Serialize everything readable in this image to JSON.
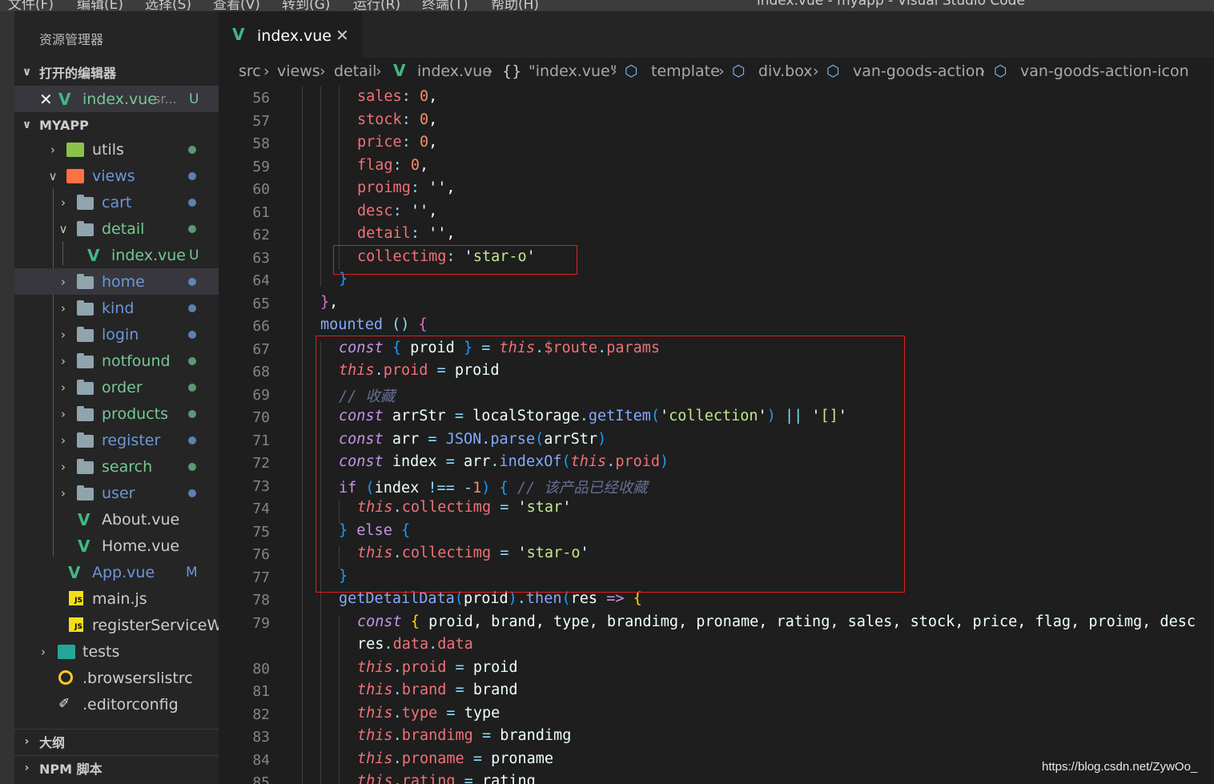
{
  "menubar": {
    "items": [
      "文件(F)",
      "编辑(E)",
      "选择(S)",
      "查看(V)",
      "转到(G)",
      "运行(R)",
      "终端(T)",
      "帮助(H)"
    ],
    "window_title": "index.vue - myapp - Visual Studio Code"
  },
  "sidebar": {
    "title": "资源管理器",
    "open_editors_header": "打开的编辑器",
    "open_editor": {
      "name": "index.vue",
      "desc": "sr...",
      "status": "U"
    },
    "project_header": "MYAPP",
    "tree": [
      {
        "name": "utils",
        "type": "folder-special",
        "status_color": "#73c991"
      },
      {
        "name": "views",
        "type": "folder-special-open",
        "status_color": "#6c97d6"
      },
      {
        "name": "cart",
        "type": "folder",
        "status_color": "#6c97d6"
      },
      {
        "name": "detail",
        "type": "folder-open",
        "status_color": "#73c991"
      },
      {
        "name": "index.vue",
        "type": "vue",
        "status": "U"
      },
      {
        "name": "home",
        "type": "folder",
        "status_color": "#6c97d6"
      },
      {
        "name": "kind",
        "type": "folder",
        "status_color": "#6c97d6"
      },
      {
        "name": "login",
        "type": "folder",
        "status_color": "#6c97d6"
      },
      {
        "name": "notfound",
        "type": "folder",
        "status_color": "#73c991"
      },
      {
        "name": "order",
        "type": "folder",
        "status_color": "#73c991"
      },
      {
        "name": "products",
        "type": "folder",
        "status_color": "#73c991"
      },
      {
        "name": "register",
        "type": "folder",
        "status_color": "#6c97d6"
      },
      {
        "name": "search",
        "type": "folder",
        "status_color": "#73c991"
      },
      {
        "name": "user",
        "type": "folder",
        "status_color": "#6c97d6"
      },
      {
        "name": "About.vue",
        "type": "vue"
      },
      {
        "name": "Home.vue",
        "type": "vue"
      },
      {
        "name": "App.vue",
        "type": "vue",
        "status": "M"
      },
      {
        "name": "main.js",
        "type": "js"
      },
      {
        "name": "registerServiceW...",
        "type": "js"
      },
      {
        "name": "tests",
        "type": "folder-test"
      },
      {
        "name": ".browserslistrc",
        "type": "browserslist"
      },
      {
        "name": ".editorconfig",
        "type": "editorconfig"
      }
    ],
    "outline_header": "大纲",
    "npm_header": "NPM 脚本"
  },
  "tabs": [
    {
      "label": "index.vue",
      "close": "✕"
    }
  ],
  "breadcrumb": [
    "src",
    "views",
    "detail",
    "index.vue",
    "\"index.vue\"",
    "template",
    "div.box",
    "van-goods-action",
    "van-goods-action-icon"
  ],
  "colors": {
    "accent_green": "#41b883",
    "highlight_box": "#e01e1e",
    "modified": "#e2c08d",
    "untracked": "#73c991"
  },
  "line_numbers": [
    "56",
    "57",
    "58",
    "59",
    "60",
    "61",
    "62",
    "63",
    "64",
    "65",
    "66",
    "67",
    "68",
    "69",
    "70",
    "71",
    "72",
    "73",
    "74",
    "75",
    "76",
    "77",
    "78",
    "79",
    "",
    "80",
    "81",
    "82",
    "83",
    "84",
    "85"
  ],
  "watermark": "https://blog.csdn.net/ZywOo_"
}
